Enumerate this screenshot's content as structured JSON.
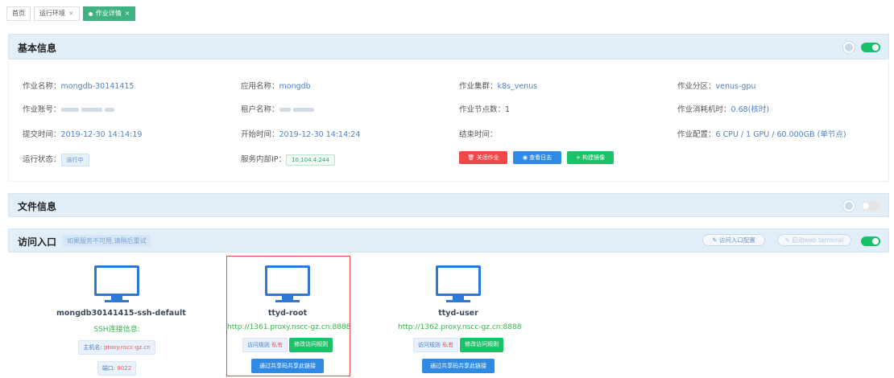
{
  "tabs": [
    {
      "label": "首页",
      "closable": false
    },
    {
      "label": "运行环境",
      "closable": true
    },
    {
      "label": "作业详情",
      "closable": true,
      "active": true
    }
  ],
  "basic": {
    "title": "基本信息",
    "fields": {
      "job_name": {
        "label": "作业名称：",
        "value": "mongdb-30141415"
      },
      "app_name": {
        "label": "应用名称：",
        "value": "mongdb"
      },
      "cluster": {
        "label": "作业集群：",
        "value": "k8s_venus"
      },
      "partition": {
        "label": "作业分区：",
        "value": "venus-gpu"
      },
      "account": {
        "label": "作业账号："
      },
      "tenant": {
        "label": "租户名称："
      },
      "nodes": {
        "label": "作业节点数：",
        "value": "1"
      },
      "cost": {
        "label": "作业消耗机时：",
        "value": "0.68(核时)"
      },
      "submit": {
        "label": "提交时间：",
        "value": "2019-12-30 14:14:19"
      },
      "start": {
        "label": "开始时间：",
        "value": "2019-12-30 14:14:24"
      },
      "end": {
        "label": "结束时间：",
        "value": ""
      },
      "config": {
        "label": "作业配置：",
        "value": "6 CPU / 1 GPU / 60.000GB (单节点)"
      },
      "status": {
        "label": "运行状态：",
        "value": "运行中"
      },
      "ip": {
        "label": "服务内部IP：",
        "value": "10.104.4.244"
      }
    },
    "actions": {
      "stop": "关闭作业",
      "log": "查看日志",
      "image": "构建镜像"
    }
  },
  "files": {
    "title": "文件信息"
  },
  "access": {
    "title": "访问入口",
    "notice": "如果服务不可用,请稍后重试",
    "config_button": "访问入口配置",
    "web_terminal_button": "启动web terminal",
    "cards": [
      {
        "name": "mongdb30141415-ssh-default",
        "sub": "SSH连接信息:",
        "host_label": "主机名",
        "host": "proxy.nscc-gz.cn",
        "port_label": "端口",
        "port": "8022"
      },
      {
        "name": "ttyd-root",
        "url": "http://1361.proxy.nscc-gz.cn:8888",
        "rule_label": "访问规则",
        "rule": "私有",
        "modify": "修改访问规则",
        "share": "通过共享码共享此链接"
      },
      {
        "name": "ttyd-user",
        "url": "http://1362.proxy.nscc-gz.cn:8888",
        "rule_label": "访问规则",
        "rule": "私有",
        "modify": "修改访问规则",
        "share": "通过共享码共享此链接"
      }
    ]
  },
  "colors": {
    "accent": "#2f8ae5",
    "success": "#1cc267",
    "danger": "#f04848",
    "header_bg": "#e3eff8"
  }
}
